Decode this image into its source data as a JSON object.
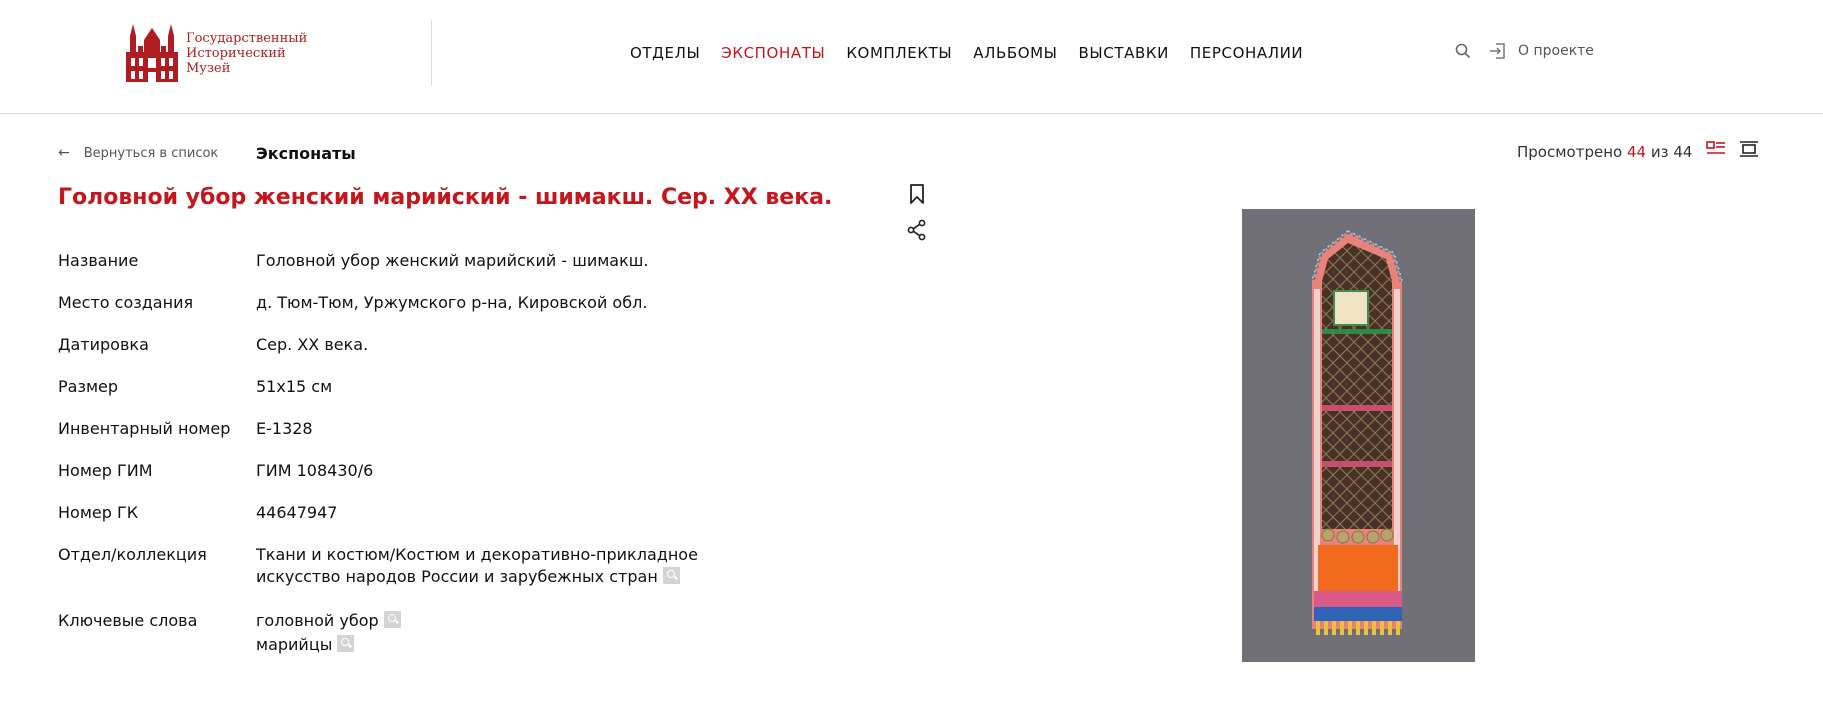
{
  "header": {
    "logo_lines": [
      "Государственный",
      "Исторический",
      "Музей"
    ],
    "nav": [
      {
        "label": "ОТДЕЛЫ",
        "active": false
      },
      {
        "label": "ЭКСПОНАТЫ",
        "active": true
      },
      {
        "label": "КОМПЛЕКТЫ",
        "active": false
      },
      {
        "label": "АЛЬБОМЫ",
        "active": false
      },
      {
        "label": "ВЫСТАВКИ",
        "active": false
      },
      {
        "label": "ПЕРСОНАЛИИ",
        "active": false
      }
    ],
    "search_icon": "search-icon",
    "about_icon": "sign-in-icon",
    "about_label": "О проекте"
  },
  "subheader": {
    "back_label": "Вернуться в список",
    "section_title": "Экспонаты",
    "viewed_prefix": "Просмотрено",
    "viewed_current": "44",
    "viewed_sep": "из",
    "viewed_total": "44"
  },
  "item": {
    "title": "Головной убор женский марийский - шимакш. Сер. XX века.",
    "properties": [
      {
        "key": "Название",
        "value": "Головной убор женский марийский - шимакш."
      },
      {
        "key": "Место создания",
        "value": "д. Тюм-Тюм, Уржумского р-на, Кировской обл."
      },
      {
        "key": "Датировка",
        "value": "Сер. XX века."
      },
      {
        "key": "Размер",
        "value": "51х15 см"
      },
      {
        "key": "Инвентарный номер",
        "value": "Е-1328"
      },
      {
        "key": "Номер ГИМ",
        "value": "ГИМ 108430/6"
      },
      {
        "key": "Номер ГК",
        "value": "44647947"
      }
    ],
    "collection_key": "Отдел/коллекция",
    "collection_value": "Ткани и костюм/Костюм и декоративно-прикладное искусство народов России и зарубежных стран",
    "keywords_key": "Ключевые слова",
    "keywords": [
      "головной убор",
      "марийцы"
    ]
  },
  "colors": {
    "accent": "#c4161c",
    "logo": "#b01c1f"
  }
}
